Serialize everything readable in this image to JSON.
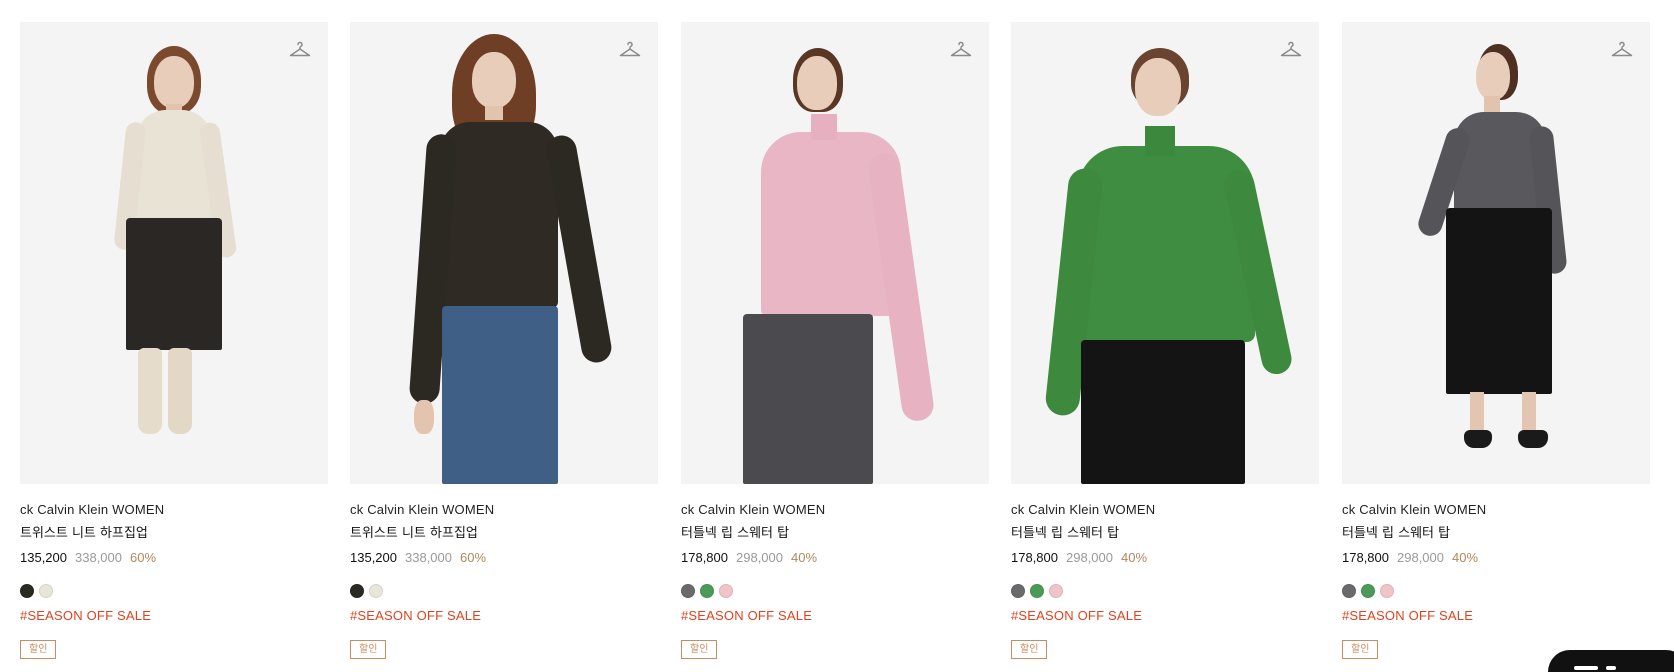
{
  "products": [
    {
      "brand": "ck Calvin Klein WOMEN",
      "name": "트위스트 니트 하프집업",
      "price_sale": "135,200",
      "price_original": "338,000",
      "discount": "60%",
      "swatches": [
        "#2a2a22",
        "#e8e6d8"
      ],
      "promo": "#SEASON OFF SALE",
      "badge": "할인",
      "icon": "hanger-icon"
    },
    {
      "brand": "ck Calvin Klein WOMEN",
      "name": "트위스트 니트 하프집업",
      "price_sale": "135,200",
      "price_original": "338,000",
      "discount": "60%",
      "swatches": [
        "#2a2a22",
        "#e8e6d8"
      ],
      "promo": "#SEASON OFF SALE",
      "badge": "할인",
      "icon": "hanger-icon"
    },
    {
      "brand": "ck Calvin Klein WOMEN",
      "name": "터틀넥 립 스웨터 탑",
      "price_sale": "178,800",
      "price_original": "298,000",
      "discount": "40%",
      "swatches": [
        "#6a6a6c",
        "#4c9a5a",
        "#f0c4c8"
      ],
      "promo": "#SEASON OFF SALE",
      "badge": "할인",
      "icon": "hanger-icon"
    },
    {
      "brand": "ck Calvin Klein WOMEN",
      "name": "터틀넥 립 스웨터 탑",
      "price_sale": "178,800",
      "price_original": "298,000",
      "discount": "40%",
      "swatches": [
        "#6a6a6c",
        "#4c9a5a",
        "#f0c4c8"
      ],
      "promo": "#SEASON OFF SALE",
      "badge": "할인",
      "icon": "hanger-icon"
    },
    {
      "brand": "ck Calvin Klein WOMEN",
      "name": "터틀넥 립 스웨터 탑",
      "price_sale": "178,800",
      "price_original": "298,000",
      "discount": "40%",
      "swatches": [
        "#6a6a6c",
        "#4c9a5a",
        "#f0c4c8"
      ],
      "promo": "#SEASON OFF SALE",
      "badge": "할인",
      "icon": "hanger-icon"
    }
  ],
  "colors": {
    "promo": "#e0411f",
    "discount": "#b0885f",
    "badge": "#c78c63"
  }
}
